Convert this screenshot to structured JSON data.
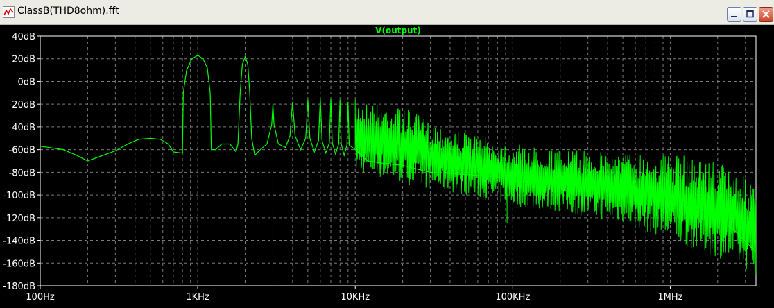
{
  "window": {
    "title": "ClassB(THD8ohm).fft"
  },
  "colors": {
    "trace": "#00ff00",
    "grid": "#7a7a7a",
    "axis": "#ffffff",
    "background": "#000000"
  },
  "icons": {
    "app": "waveform-icon",
    "minimize": "minimize-icon",
    "maximize": "maximize-icon",
    "close": "close-icon"
  },
  "chart_data": {
    "type": "line",
    "title": "V(output)",
    "xscale": "log",
    "xlim": [
      100,
      3500000
    ],
    "ylim": [
      -180,
      40
    ],
    "xticks": [
      {
        "value": 100,
        "label": "100Hz"
      },
      {
        "value": 1000,
        "label": "1KHz"
      },
      {
        "value": 10000,
        "label": "10KHz"
      },
      {
        "value": 100000,
        "label": "100KHz"
      },
      {
        "value": 1000000,
        "label": "1MHz"
      }
    ],
    "yticks": [
      {
        "value": 40,
        "label": "40dB"
      },
      {
        "value": 20,
        "label": "20dB"
      },
      {
        "value": 0,
        "label": "0dB"
      },
      {
        "value": -20,
        "label": "-20dB"
      },
      {
        "value": -40,
        "label": "-40dB"
      },
      {
        "value": -60,
        "label": "-60dB"
      },
      {
        "value": -80,
        "label": "-80dB"
      },
      {
        "value": -100,
        "label": "-100dB"
      },
      {
        "value": -120,
        "label": "-120dB"
      },
      {
        "value": -140,
        "label": "-140dB"
      },
      {
        "value": -160,
        "label": "-160dB"
      },
      {
        "value": -180,
        "label": "-180dB"
      }
    ],
    "grid": true,
    "series": [
      {
        "name": "V(output)",
        "points": [
          [
            100,
            -57
          ],
          [
            140,
            -60
          ],
          [
            170,
            -65
          ],
          [
            200,
            -70
          ],
          [
            240,
            -66
          ],
          [
            300,
            -61
          ],
          [
            360,
            -55
          ],
          [
            420,
            -51
          ],
          [
            500,
            -50
          ],
          [
            580,
            -51
          ],
          [
            650,
            -55
          ],
          [
            700,
            -62
          ],
          [
            780,
            -63
          ],
          [
            800,
            -63
          ],
          [
            810,
            -10
          ],
          [
            850,
            10
          ],
          [
            920,
            20
          ],
          [
            1000,
            23
          ],
          [
            1080,
            20
          ],
          [
            1150,
            12
          ],
          [
            1200,
            -10
          ],
          [
            1220,
            -60
          ],
          [
            1300,
            -60
          ],
          [
            1420,
            -55
          ],
          [
            1600,
            -55
          ],
          [
            1750,
            -62
          ],
          [
            1800,
            -55
          ],
          [
            1860,
            -10
          ],
          [
            1920,
            15
          ],
          [
            2000,
            22
          ],
          [
            2080,
            15
          ],
          [
            2140,
            -10
          ],
          [
            2200,
            -50
          ],
          [
            2300,
            -65
          ],
          [
            2500,
            -60
          ],
          [
            2750,
            -55
          ],
          [
            2950,
            -38
          ],
          [
            3000,
            -20
          ],
          [
            3050,
            -38
          ],
          [
            3250,
            -55
          ],
          [
            3600,
            -58
          ],
          [
            3850,
            -48
          ],
          [
            4000,
            -18
          ],
          [
            4150,
            -48
          ],
          [
            4500,
            -60
          ],
          [
            4850,
            -50
          ],
          [
            5000,
            -16
          ],
          [
            5150,
            -50
          ],
          [
            5500,
            -62
          ],
          [
            5850,
            -52
          ],
          [
            6000,
            -14
          ],
          [
            6150,
            -52
          ],
          [
            6500,
            -63
          ],
          [
            6850,
            -54
          ],
          [
            7000,
            -15
          ],
          [
            7150,
            -54
          ],
          [
            7500,
            -64
          ],
          [
            7850,
            -55
          ],
          [
            8000,
            -16
          ],
          [
            8150,
            -55
          ],
          [
            8500,
            -65
          ],
          [
            8850,
            -56
          ],
          [
            9000,
            -18
          ],
          [
            9150,
            -56
          ],
          [
            10000,
            -60
          ],
          [
            12000,
            -70
          ],
          [
            15000,
            -72
          ],
          [
            20000,
            -74
          ],
          [
            30000,
            -80
          ],
          [
            50000,
            -82
          ],
          [
            80000,
            -84
          ],
          [
            100000,
            -87
          ],
          [
            150000,
            -90
          ],
          [
            300000,
            -92
          ],
          [
            600000,
            -95
          ],
          [
            1000000,
            -100
          ],
          [
            1500000,
            -110
          ],
          [
            2500000,
            -130
          ],
          [
            3500000,
            -150
          ]
        ],
        "envelope": [
          [
            10000,
            -16
          ],
          [
            20000,
            -22
          ],
          [
            30000,
            -35
          ],
          [
            50000,
            -45
          ],
          [
            70000,
            -50
          ],
          [
            100000,
            -55
          ],
          [
            200000,
            -60
          ],
          [
            500000,
            -62
          ],
          [
            1000000,
            -64
          ],
          [
            1500000,
            -66
          ],
          [
            2000000,
            -70
          ],
          [
            2500000,
            -76
          ],
          [
            3000000,
            -85
          ],
          [
            3500000,
            -95
          ]
        ],
        "floor": [
          [
            10000,
            -80
          ],
          [
            20000,
            -90
          ],
          [
            30000,
            -95
          ],
          [
            50000,
            -100
          ],
          [
            70000,
            -105
          ],
          [
            100000,
            -110
          ],
          [
            200000,
            -115
          ],
          [
            500000,
            -125
          ],
          [
            1000000,
            -140
          ],
          [
            1500000,
            -150
          ],
          [
            2000000,
            -155
          ],
          [
            2500000,
            -160
          ],
          [
            3500000,
            -170
          ]
        ]
      }
    ]
  }
}
